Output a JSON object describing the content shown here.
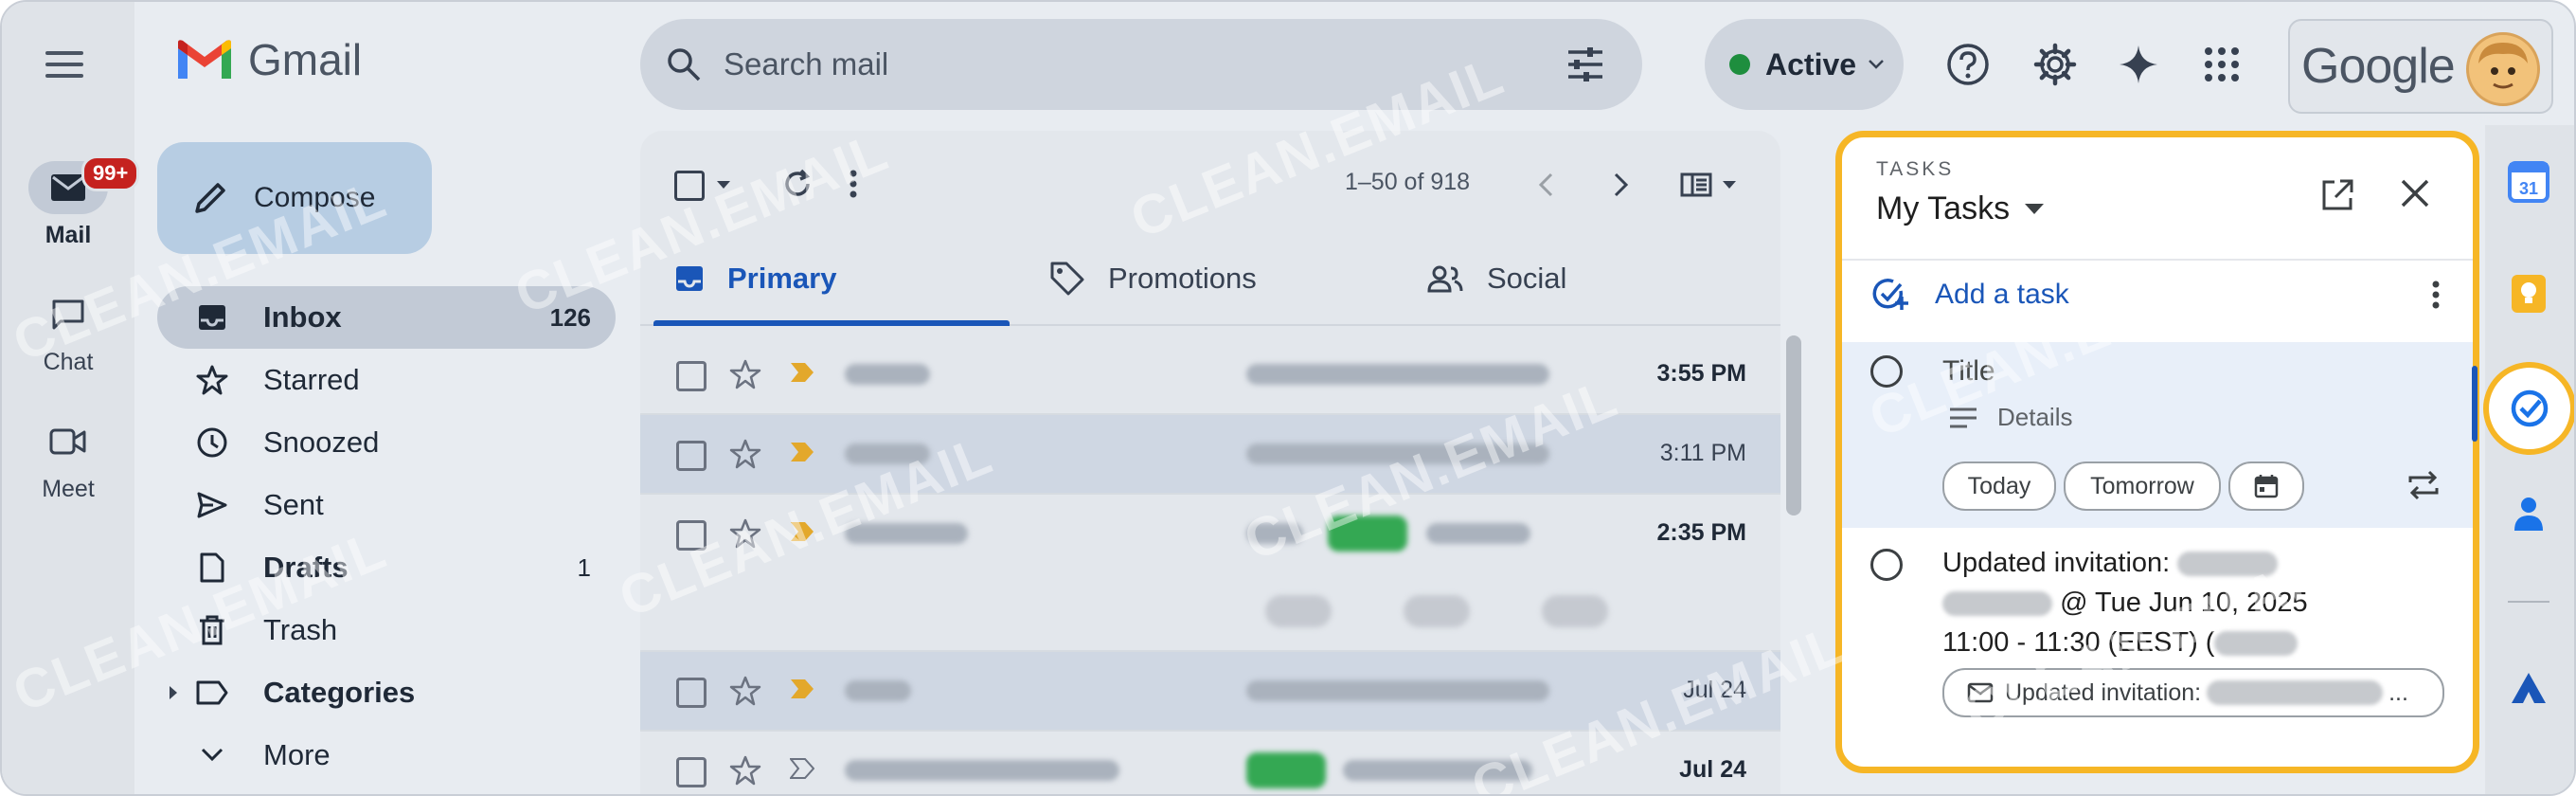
{
  "app": {
    "name": "Gmail"
  },
  "rail": {
    "items": [
      {
        "label": "Mail",
        "badge": "99+"
      },
      {
        "label": "Chat"
      },
      {
        "label": "Meet"
      }
    ]
  },
  "search": {
    "placeholder": "Search mail"
  },
  "status": {
    "label": "Active",
    "color": "#1e8e3e"
  },
  "account": {
    "brand": "Google"
  },
  "compose": {
    "label": "Compose"
  },
  "nav": [
    {
      "label": "Inbox",
      "count": "126",
      "icon": "inbox-icon"
    },
    {
      "label": "Starred",
      "count": "",
      "icon": "star-icon"
    },
    {
      "label": "Snoozed",
      "count": "",
      "icon": "clock-icon"
    },
    {
      "label": "Sent",
      "count": "",
      "icon": "send-icon"
    },
    {
      "label": "Drafts",
      "count": "1",
      "icon": "draft-icon"
    },
    {
      "label": "Trash",
      "count": "",
      "icon": "trash-icon"
    },
    {
      "label": "Categories",
      "count": "",
      "icon": "label-icon"
    },
    {
      "label": "More",
      "count": "",
      "icon": "chevron-down-icon"
    }
  ],
  "list": {
    "pagination": "1–50 of 918",
    "tabs": [
      {
        "label": "Primary"
      },
      {
        "label": "Promotions"
      },
      {
        "label": "Social"
      }
    ],
    "rows": [
      {
        "time": "3:55 PM",
        "unread": true
      },
      {
        "time": "3:11 PM",
        "unread": false
      },
      {
        "time": "2:35 PM",
        "unread": true
      },
      {
        "time": "Jul 24",
        "unread": false
      },
      {
        "time": "Jul 24",
        "unread": true
      }
    ]
  },
  "tasks": {
    "eyebrow": "TASKS",
    "list_name": "My Tasks",
    "add_label": "Add a task",
    "new_task": {
      "title_placeholder": "Title",
      "details_placeholder": "Details",
      "chips": [
        "Today",
        "Tomorrow"
      ]
    },
    "task2": {
      "line1": "Updated invitation:",
      "line2": "@ Tue Jun 10, 2025",
      "line3": "11:00 - 11:30 (EEST) (",
      "chip": "Updated invitation:",
      "chip_suffix": "..."
    }
  },
  "watermark": "CLEAN.EMAIL",
  "colors": {
    "accent": "#1a56b8",
    "highlight": "#f6b626"
  }
}
